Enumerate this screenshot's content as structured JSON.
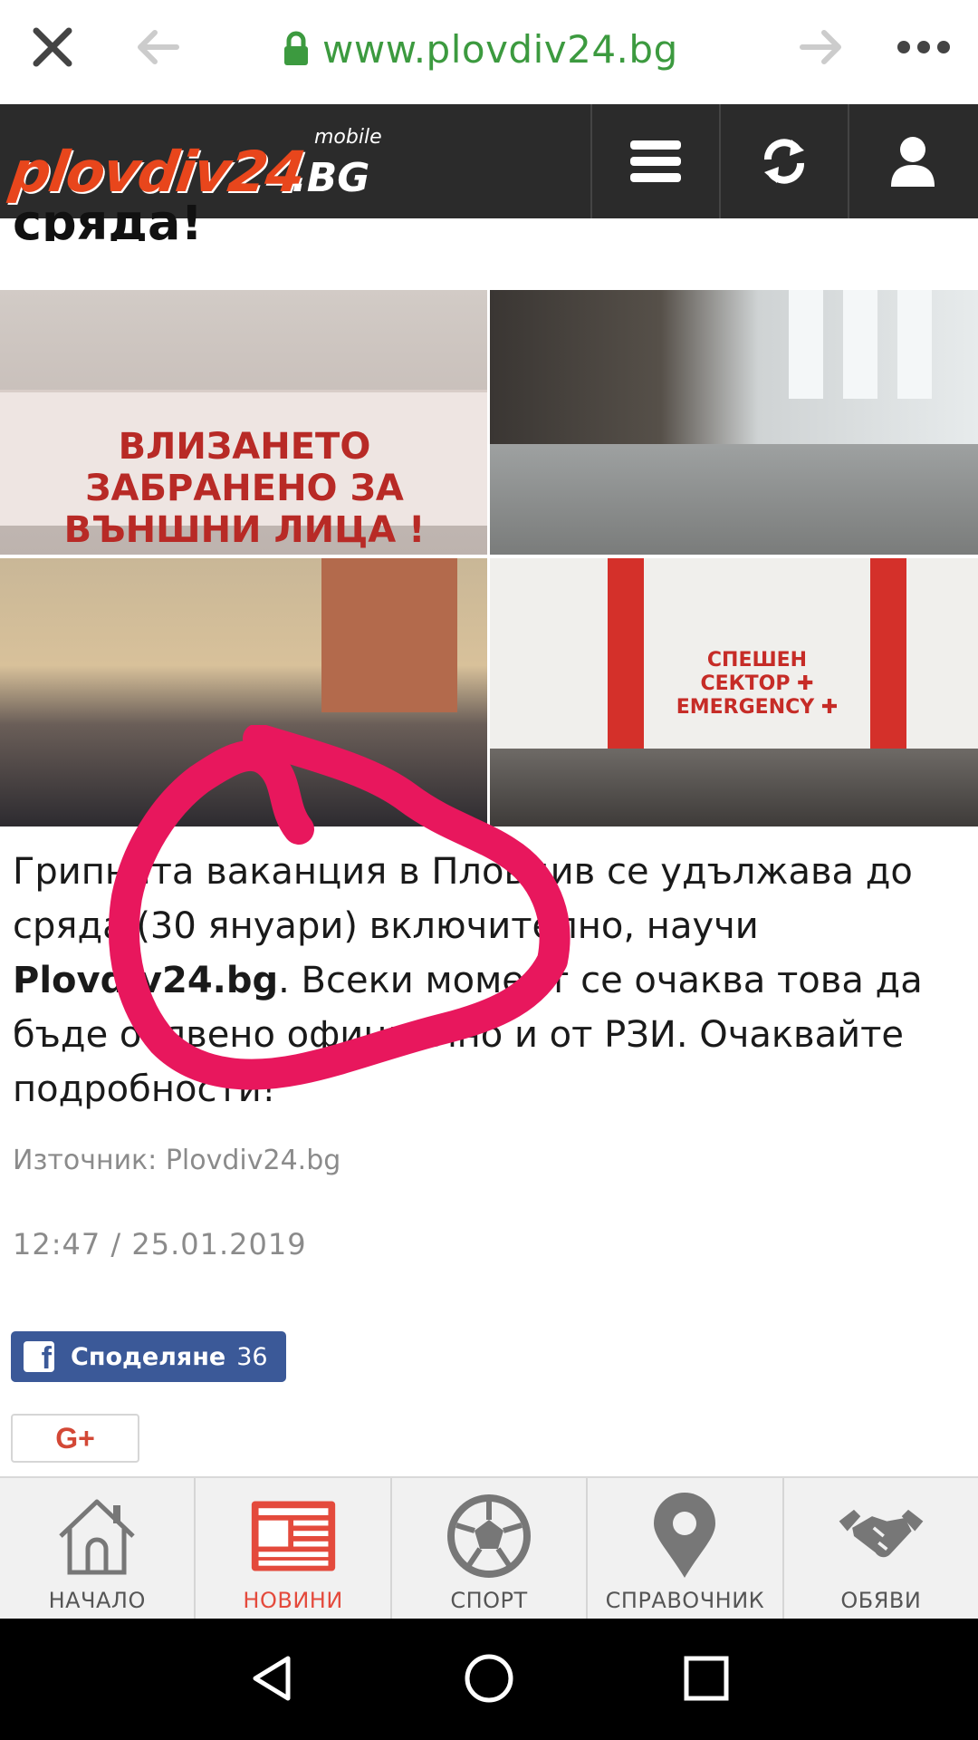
{
  "browser": {
    "url": "www.plovdiv24.bg",
    "close_icon": "close-icon",
    "back_icon": "arrow-left-icon",
    "forward_icon": "arrow-right-icon",
    "more_icon": "more-horizontal-icon",
    "lock_color": "#3c9a3f"
  },
  "site": {
    "logo_main": "plovdiv24",
    "logo_suffix": ".BG",
    "logo_mobile": "mobile",
    "brand_color": "#e8461c"
  },
  "article": {
    "headline_tail": "сряда!",
    "photo_sign_text": "ВЛИЗАНЕТО ЗАБРАНЕНО ЗА ВЪНШНИ ЛИЦА !",
    "photo_sign2_text": "СПЕШЕН СЕКТОР ✚ EMERGENCY ✚",
    "body_part1": "Грипната ваканция в Пловдив се удължава до сряда (30 януари) включително, научи ",
    "body_bold": "Plovdiv24.bg",
    "body_part2": ". Всеки момент се очаква това да бъде обявено официално и от РЗИ. Очаквайте подробности!",
    "source": "Източник: Plovdiv24.bg",
    "timestamp": "12:47 / 25.01.2019"
  },
  "share": {
    "facebook_label": "Споделяне",
    "facebook_count": "36",
    "gplus_label": "G+"
  },
  "tabs": [
    {
      "label": "НАЧАЛО",
      "icon": "home-icon",
      "active": false
    },
    {
      "label": "НОВИНИ",
      "icon": "newspaper-icon",
      "active": true
    },
    {
      "label": "СПОРТ",
      "icon": "soccer-ball-icon",
      "active": false
    },
    {
      "label": "СПРАВОЧНИК",
      "icon": "map-pin-icon",
      "active": false
    },
    {
      "label": "ОБЯВИ",
      "icon": "handshake-icon",
      "active": false
    }
  ],
  "colors": {
    "active_tab": "#e44a3c",
    "facebook": "#3b5998",
    "annotation": "#e8175d"
  }
}
